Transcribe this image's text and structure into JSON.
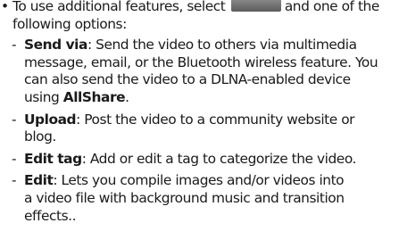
{
  "intro": {
    "bullet": "•",
    "before_key": "To use additional features, select",
    "menu_key_icon": "more-options-key-icon",
    "menu_key_glyph": "···",
    "after_key": "and one of the",
    "line2": "following options:"
  },
  "options": [
    {
      "dash": "-",
      "term": "Send via",
      "line1_rest": ": Send the video to others via multimedia",
      "line2": "message, email, or the Bluetooth wireless feature. You",
      "line3": "can also send the video to a DLNA-enabled device",
      "line4_before": "using ",
      "line4_term": "AllShare",
      "line4_after": "."
    },
    {
      "dash": "-",
      "term": "Upload",
      "line1_rest": ": Post the video to a community website or",
      "line2": "blog."
    },
    {
      "dash": "-",
      "term": "Edit tag",
      "line1_rest": ": Add or edit a tag to categorize the video."
    },
    {
      "dash": "-",
      "term": "Edit",
      "line1_rest": ": Lets you compile images and/or videos into",
      "line2": "a video file with background music and transition",
      "line3": "effects.."
    }
  ]
}
